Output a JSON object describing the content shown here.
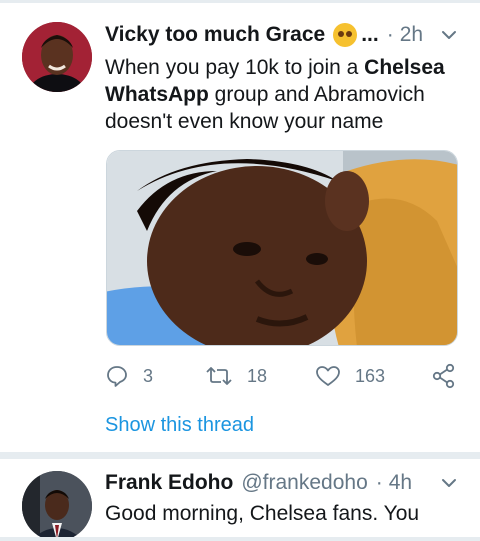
{
  "tweets": [
    {
      "display_name": "Vicky too much Grace",
      "emoji": "smiling-face-with-heart-eyes",
      "truncation": "...",
      "separator": "·",
      "time": "2h",
      "text_parts": [
        "When you pay 10k to join a ",
        "Chelsea WhatsApp",
        " group and Abramovich doesn't even know your name"
      ],
      "replies": "3",
      "retweets": "18",
      "likes": "163",
      "show_thread": "Show this thread"
    },
    {
      "display_name": "Frank Edoho",
      "handle": "@frankedoho",
      "separator": "·",
      "time": "4h",
      "text": "Good morning, Chelsea fans. You"
    }
  ],
  "colors": {
    "link": "#1b95e0",
    "muted": "#657786",
    "text": "#14171a",
    "divider": "#e6ecf0"
  },
  "icons": [
    "chevron-down-icon",
    "reply-icon",
    "retweet-icon",
    "like-icon",
    "share-icon"
  ]
}
